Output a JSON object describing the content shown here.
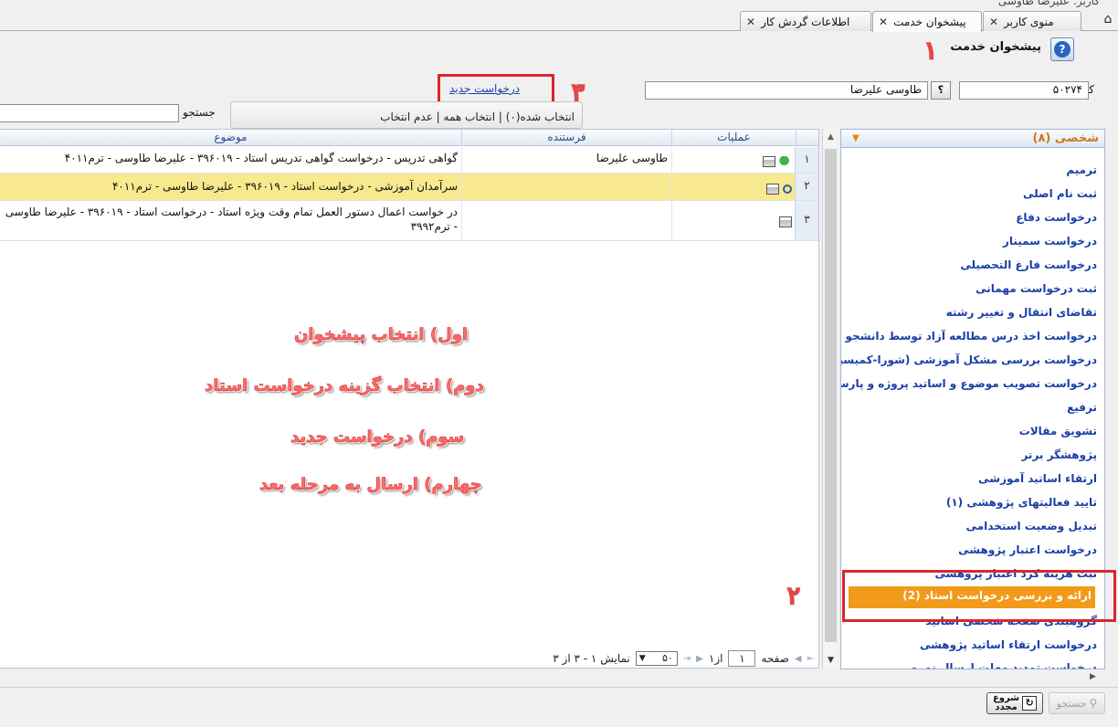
{
  "header": {
    "top_user_text": "کاربر: علیرضا طاوسی"
  },
  "tabs": [
    {
      "label": "منوی کاربر"
    },
    {
      "label": "پیشخوان خدمت"
    },
    {
      "label": "اطلاعات گردش کار"
    }
  ],
  "page": {
    "title": "پیشخوان خدمت",
    "help_icon_glyph": "?"
  },
  "user_row": {
    "label": "کاربر",
    "code": "۵۰۲۷۴",
    "lookup_glyph": "؟",
    "name": "طاوسی علیرضا"
  },
  "actions": {
    "new_request": "درخواست جدید"
  },
  "search": {
    "label": "جستجو",
    "value": ""
  },
  "selection": {
    "text": "انتخاب شده(۰) | انتخاب همه | عدم انتخاب"
  },
  "grid": {
    "columns": {
      "operations": "عملیات",
      "sender": "فرستنده",
      "subject": "موضوع"
    },
    "rows": [
      {
        "num": "۱",
        "sender": "طاوسی علیرضا",
        "subject": "گواهی تدریس - درخواست گواهی تدریس استاد - ۳۹۶۰۱۹ - علیرضا طاوسی - ترم۴۰۱۱"
      },
      {
        "num": "۲",
        "sender": "",
        "subject": "سرآمدان آموزشی - درخواست استاد - ۳۹۶۰۱۹ - علیرضا طاوسی - ترم۴۰۱۱"
      },
      {
        "num": "۳",
        "sender": "",
        "subject": "در خواست اعمال دستور العمل تمام وقت ویژه استاد - درخواست استاد - ۳۹۶۰۱۹ - علیرضا طاوسی - ترم۳۹۹۲"
      }
    ]
  },
  "pager": {
    "page_label": "صفحه",
    "page_value": "۱",
    "of_text": "از۱",
    "page_size": "۵۰",
    "display_text": "نمایش ۱ - ۳ از ۳"
  },
  "annotations": {
    "step1_num": "۱",
    "step2_num": "۲",
    "step3_num": "۳",
    "instr1": "اول) انتخاب پیشخوان",
    "instr2": "دوم) انتخاب گزینه درخواست استاد",
    "instr3": "سوم) درخواست جدید",
    "instr4": "چهارم) ارسال به مرحله بعد"
  },
  "side_panel": {
    "header": "شخصی (۸)",
    "items": [
      "ترمیم",
      "ثبت نام اصلی",
      "درخواست دفاع",
      "درخواست سمینار",
      "درخواست فارغ التحصیلی",
      "ثبت درخواست مهمانی",
      "تقاضای انتقال و تغییر رشته",
      "درخواست اخذ درس مطالعه آزاد توسط دانشجو",
      "درخواست بررسی مشکل آموزشی (شورا-کمیسیون)",
      "درخواست تصویب موضوع و اساتید پروژه و پارسا",
      "ترفیع",
      "تشویق مقالات",
      "پژوهشگر برتر",
      "ارتقاء اساتید آموزشی",
      "تایید فعالیتهای پژوهشی (۱)",
      "تبدیل وضعیت استخدامی",
      "درخواست اعتبار پژوهشی",
      "ثبت هزینه کرد اعتبار پژوهشی",
      "ارائه و بررسی درخواست استاد (2)",
      "گروهبندی صفحه شخصی اساتید",
      "درخواست ارتقاء اساتید پژوهشی",
      "درخواست تمدید مهلت ارسال نمره"
    ]
  },
  "toolbar": {
    "search_btn": "جستجو",
    "restart_btn_line1": "شروع",
    "restart_btn_line2": "مجدد"
  }
}
